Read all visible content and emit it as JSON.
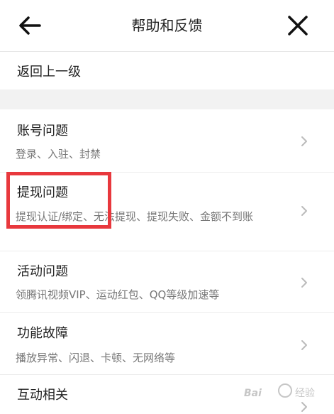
{
  "header": {
    "title": "帮助和反馈",
    "back_icon": "back-arrow-icon",
    "close_icon": "close-icon"
  },
  "back_row": {
    "label": "返回上一级"
  },
  "items": [
    {
      "label": "账号问题",
      "desc": "登录、入驻、封禁"
    },
    {
      "label": "提现问题",
      "desc": "提现认证/绑定、无法提现、提现失败、金额不到账"
    },
    {
      "label": "活动问题",
      "desc": "领腾讯视频VIP、运动红包、QQ等级加速等"
    },
    {
      "label": "功能故障",
      "desc": "播放异常、闪退、卡顿、无网络等"
    },
    {
      "label": "互动相关",
      "desc": ""
    }
  ],
  "highlight_color": "#e8383d",
  "watermark": {
    "text_latin": "Bai",
    "text_cn": "经验"
  }
}
